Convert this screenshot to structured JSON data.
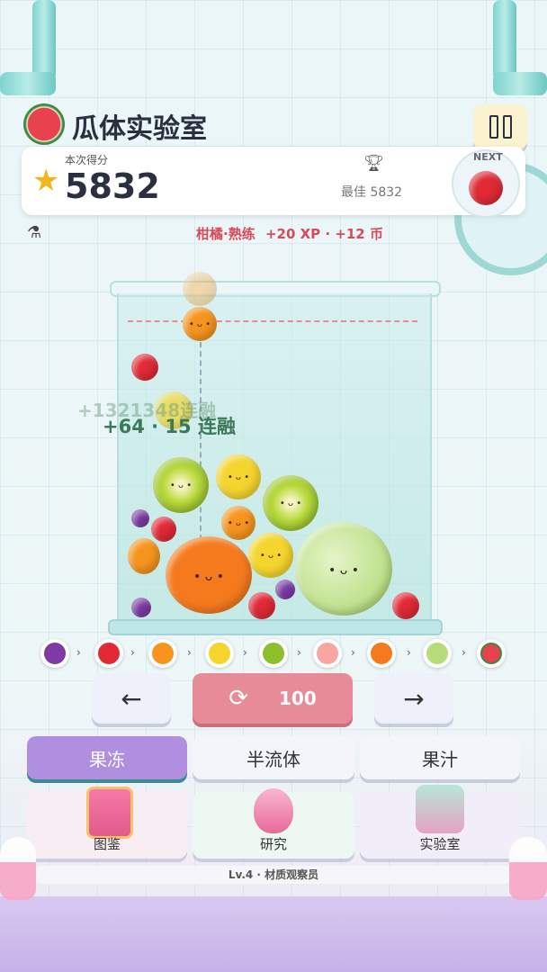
{
  "header": {
    "title": "瓜体实验室",
    "pause_icon": "pause-icon"
  },
  "score": {
    "label": "本次得分",
    "value": "5832",
    "best_label": "最佳",
    "best_value": "5832",
    "next_label": "NEXT"
  },
  "status": {
    "text_a": "柑橘·熟练",
    "text_b": "+20 XP · +12 币"
  },
  "combo": {
    "ghost": "+1321348连融",
    "text": "+64 · 15 连融"
  },
  "evolution": [
    "grape",
    "cherry",
    "orange",
    "lemon",
    "kiwi",
    "peach",
    "persimmon",
    "melon",
    "watermelon"
  ],
  "controls": {
    "left_icon": "arrow-left-icon",
    "refresh_icon": "refresh-icon",
    "refresh_count": "100",
    "right_icon": "arrow-right-icon"
  },
  "modes": [
    "果冻",
    "半流体",
    "果汁"
  ],
  "features": [
    "图鉴",
    "研究",
    "实验室"
  ],
  "footer": {
    "level": "Lv.4 · 材质观察员"
  },
  "colors": {
    "accent": "#b08ee0",
    "refresh": "#e88b98",
    "status_red": "#d84a5a",
    "combo_green": "#3a7a5a"
  }
}
